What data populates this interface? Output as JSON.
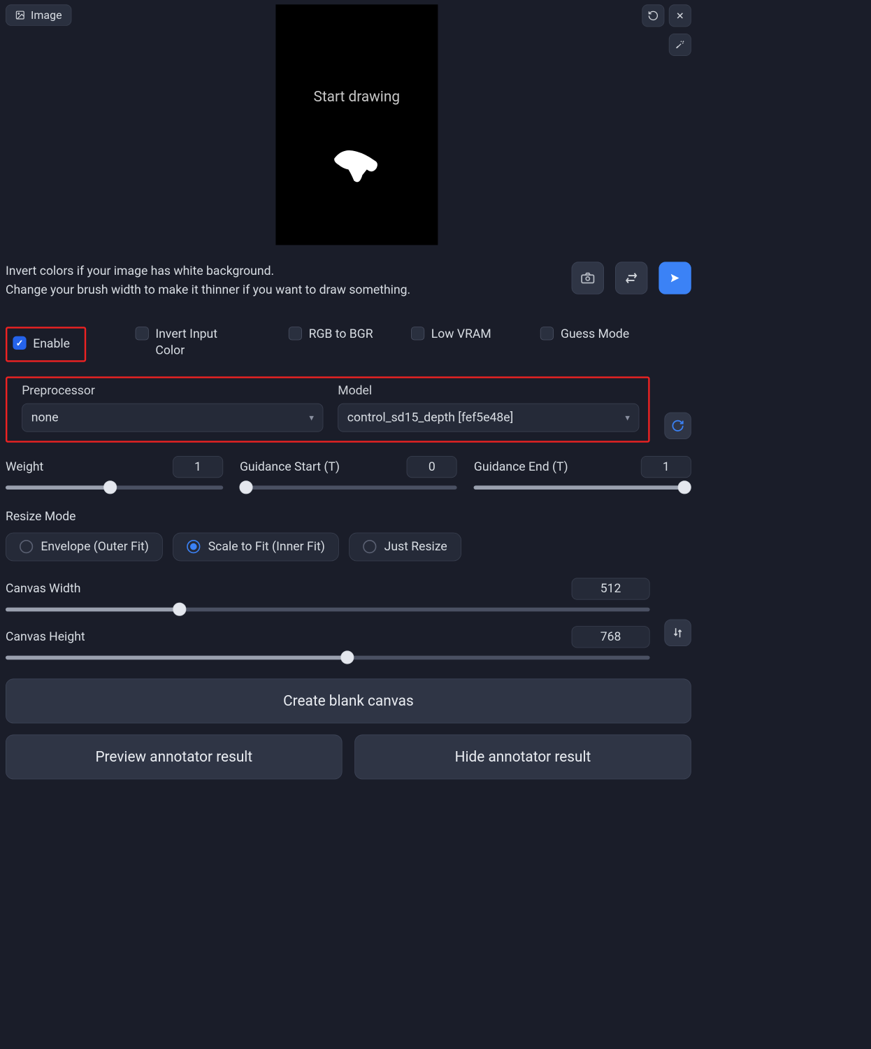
{
  "tab": {
    "label": "Image"
  },
  "canvas": {
    "text": "Start drawing"
  },
  "hint": {
    "line1": "Invert colors if your image has white background.",
    "line2": "Change your brush width to make it thinner if you want to draw something."
  },
  "checks": {
    "enable": "Enable",
    "invert": "Invert Input Color",
    "rgb": "RGB to BGR",
    "lowvram": "Low VRAM",
    "guess": "Guess Mode"
  },
  "preproc": {
    "label": "Preprocessor",
    "value": "none"
  },
  "model": {
    "label": "Model",
    "value": "control_sd15_depth [fef5e48e]"
  },
  "weight": {
    "label": "Weight",
    "value": "1",
    "pct": 48
  },
  "gstart": {
    "label": "Guidance Start (T)",
    "value": "0",
    "pct": 3
  },
  "gend": {
    "label": "Guidance End (T)",
    "value": "1",
    "pct": 97
  },
  "resize": {
    "label": "Resize Mode",
    "opt1": "Envelope (Outer Fit)",
    "opt2": "Scale to Fit (Inner Fit)",
    "opt3": "Just Resize"
  },
  "cw": {
    "label": "Canvas Width",
    "value": "512",
    "pct": 27
  },
  "ch": {
    "label": "Canvas Height",
    "value": "768",
    "pct": 53
  },
  "buttons": {
    "blank": "Create blank canvas",
    "preview": "Preview annotator result",
    "hide": "Hide annotator result"
  }
}
